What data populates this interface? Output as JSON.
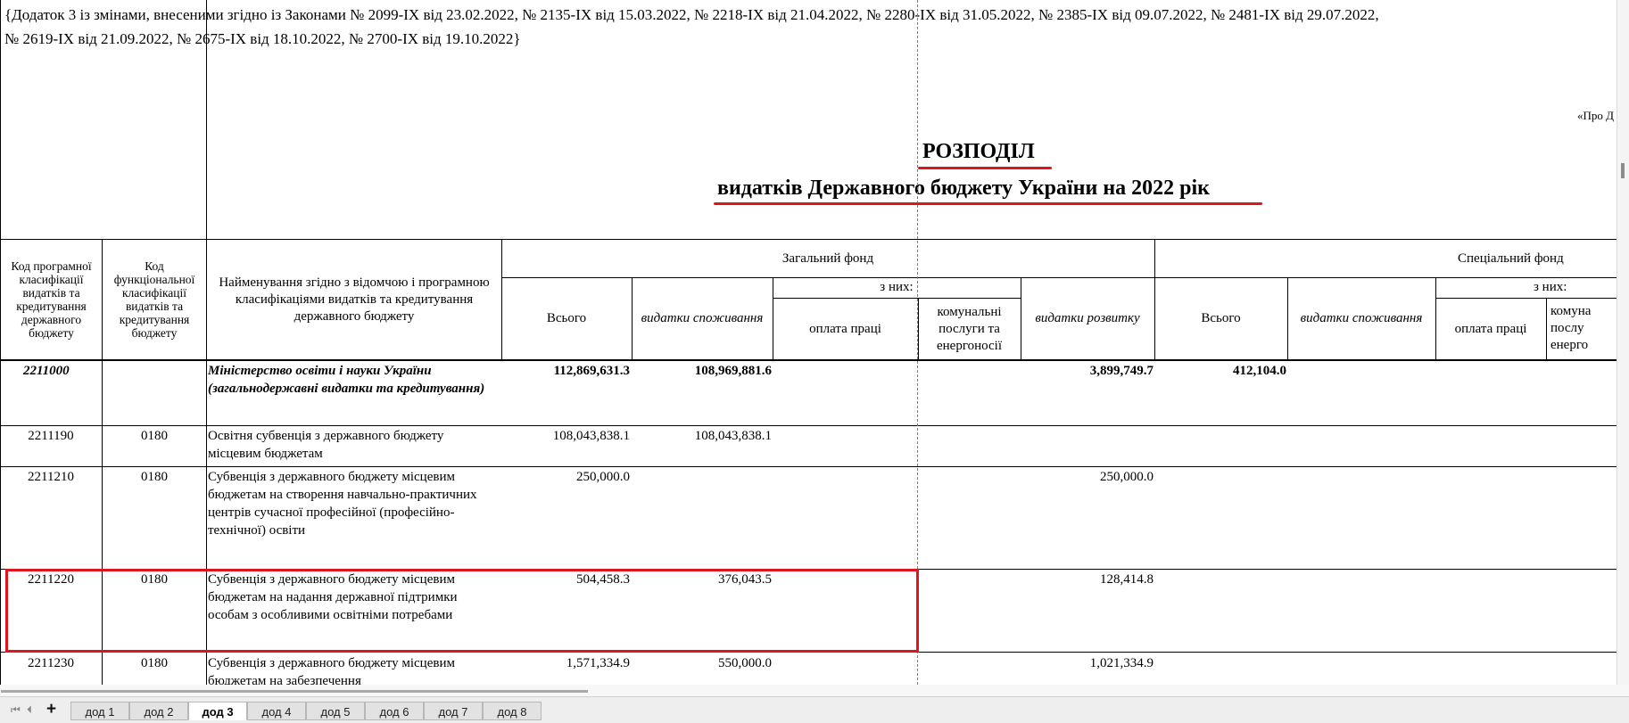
{
  "note": {
    "line1": "{Додаток 3 із змінами, внесеними згідно із Законами № 2099-IX від 23.02.2022, № 2135-IX від 15.03.2022, № 2218-IX від 21.04.2022, № 2280-IX від 31.05.2022, № 2385-IX від 09.07.2022, № 2481-IX від 29.07.2022,",
    "line2": "№ 2619-IX від 21.09.2022, № 2675-IX від 18.10.2022, № 2700-IX від 19.10.2022}"
  },
  "cut_right_text": "«Про Д",
  "title": {
    "main": "РОЗПОДІЛ",
    "sub": "видатків Державного бюджету України на 2022 рік"
  },
  "headers": {
    "code_prog": "Код програмної класифікації видатків та кредитування державного бюджету",
    "code_func": "Код функціональної класифікації видатків та кредитування бюджету",
    "name": "Найменування згідно з відомчою і програмною класифікаціями видатків та кредитування державного бюджету",
    "general_fund": "Загальний фонд",
    "special_fund": "Спеціальний фонд",
    "total": "Всього",
    "consumption": "видатки споживання",
    "of_which": "з них:",
    "wages": "оплата праці",
    "utilities": "комунальні послуги та енергоносії",
    "development": "видатки розвитку",
    "sp_total": "Всього",
    "sp_consumption": "видатки споживання",
    "sp_of_which": "з них:",
    "sp_wages": "оплата праці",
    "sp_utilities_cut": "комуна послу енерго"
  },
  "rows": [
    {
      "code": "2211000",
      "func": "",
      "name": "Міністерство освіти і науки України (загальнодержавні видатки та кредитування)",
      "total": "112,869,631.3",
      "consumption": "108,969,881.6",
      "development": "3,899,749.7",
      "sp_total": "412,104.0"
    },
    {
      "code": "2211190",
      "func": "0180",
      "name": "Освітня субвенція з державного бюджету місцевим бюджетам",
      "total": "108,043,838.1",
      "consumption": "108,043,838.1",
      "development": "",
      "sp_total": ""
    },
    {
      "code": "2211210",
      "func": "0180",
      "name": "Субвенція з державного бюджету місцевим бюджетам на створення навчально-практичних центрів сучасної професійної (професійно-технічної) освіти",
      "total": "250,000.0",
      "consumption": "",
      "development": "250,000.0",
      "sp_total": ""
    },
    {
      "code": "2211220",
      "func": "0180",
      "name": "Субвенція з державного бюджету місцевим бюджетам на надання державної підтримки особам з особливими освітніми потребами",
      "total": "504,458.3",
      "consumption": "376,043.5",
      "development": "128,414.8",
      "sp_total": ""
    },
    {
      "code": "2211230",
      "func": "0180",
      "name": "Субвенція з державного бюджету місцевим бюджетам на забезпечення",
      "total": "1,571,334.9",
      "consumption": "550,000.0",
      "development": "1,021,334.9",
      "sp_total": ""
    }
  ],
  "tabs": [
    "дод 1",
    "дод 2",
    "дод 3",
    "дод 4",
    "дод 5",
    "дод 6",
    "дод 7",
    "дод 8"
  ],
  "active_tab": "дод 3",
  "tab_controls": {
    "first": "⏮",
    "prev": "⏴",
    "add": "+"
  },
  "colors": {
    "highlight": "#e0141e"
  }
}
